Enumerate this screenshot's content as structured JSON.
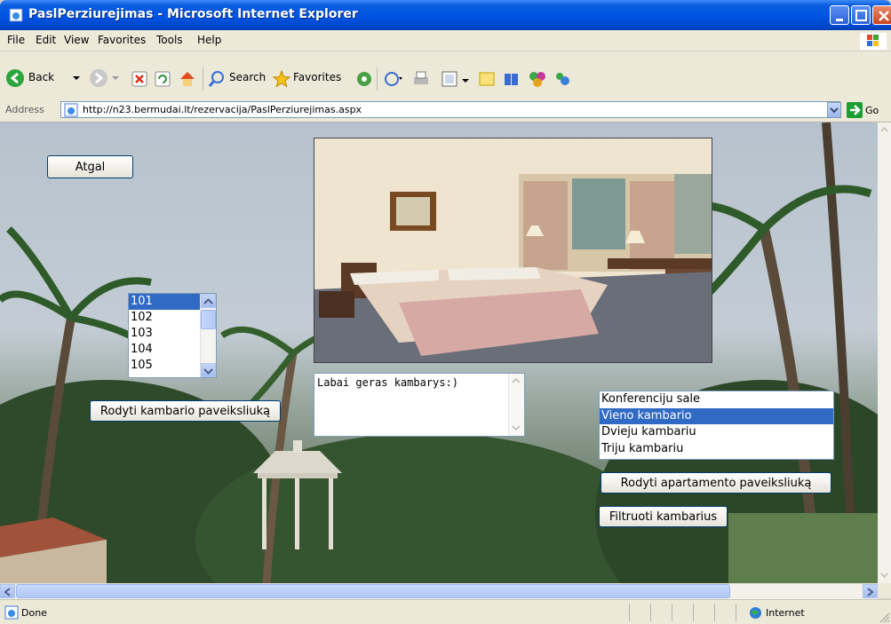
{
  "window": {
    "title": "PaslPerziurejimas - Microsoft Internet Explorer"
  },
  "menu": {
    "items": [
      "File",
      "Edit",
      "View",
      "Favorites",
      "Tools",
      "Help"
    ]
  },
  "toolbar": {
    "back_label": "Back",
    "search_label": "Search",
    "favorites_label": "Favorites"
  },
  "address": {
    "label": "Address",
    "url": "http://n23.bermudai.lt/rezervacija/PaslPerziurejimas.aspx",
    "go_label": "Go"
  },
  "page": {
    "back_button": "Atgal",
    "room_numbers": [
      "101",
      "102",
      "103",
      "104",
      "105"
    ],
    "room_selected": "101",
    "show_room_photo_button": "Rodyti kambario paveiksliuką",
    "description": "Labai geras kambarys:)",
    "room_types": [
      "Konferenciju sale",
      "Vieno kambario",
      "Dvieju kambariu",
      "Triju kambariu"
    ],
    "room_type_selected": "Vieno kambario",
    "show_apartment_photo_button": "Rodyti apartamento paveiksliuką",
    "filter_button": "Filtruoti kambarius"
  },
  "status": {
    "text": "Done",
    "zone": "Internet"
  },
  "colors": {
    "selection": "#316ac5",
    "titlebar": "#0054e3",
    "chrome": "#ece9d8"
  }
}
